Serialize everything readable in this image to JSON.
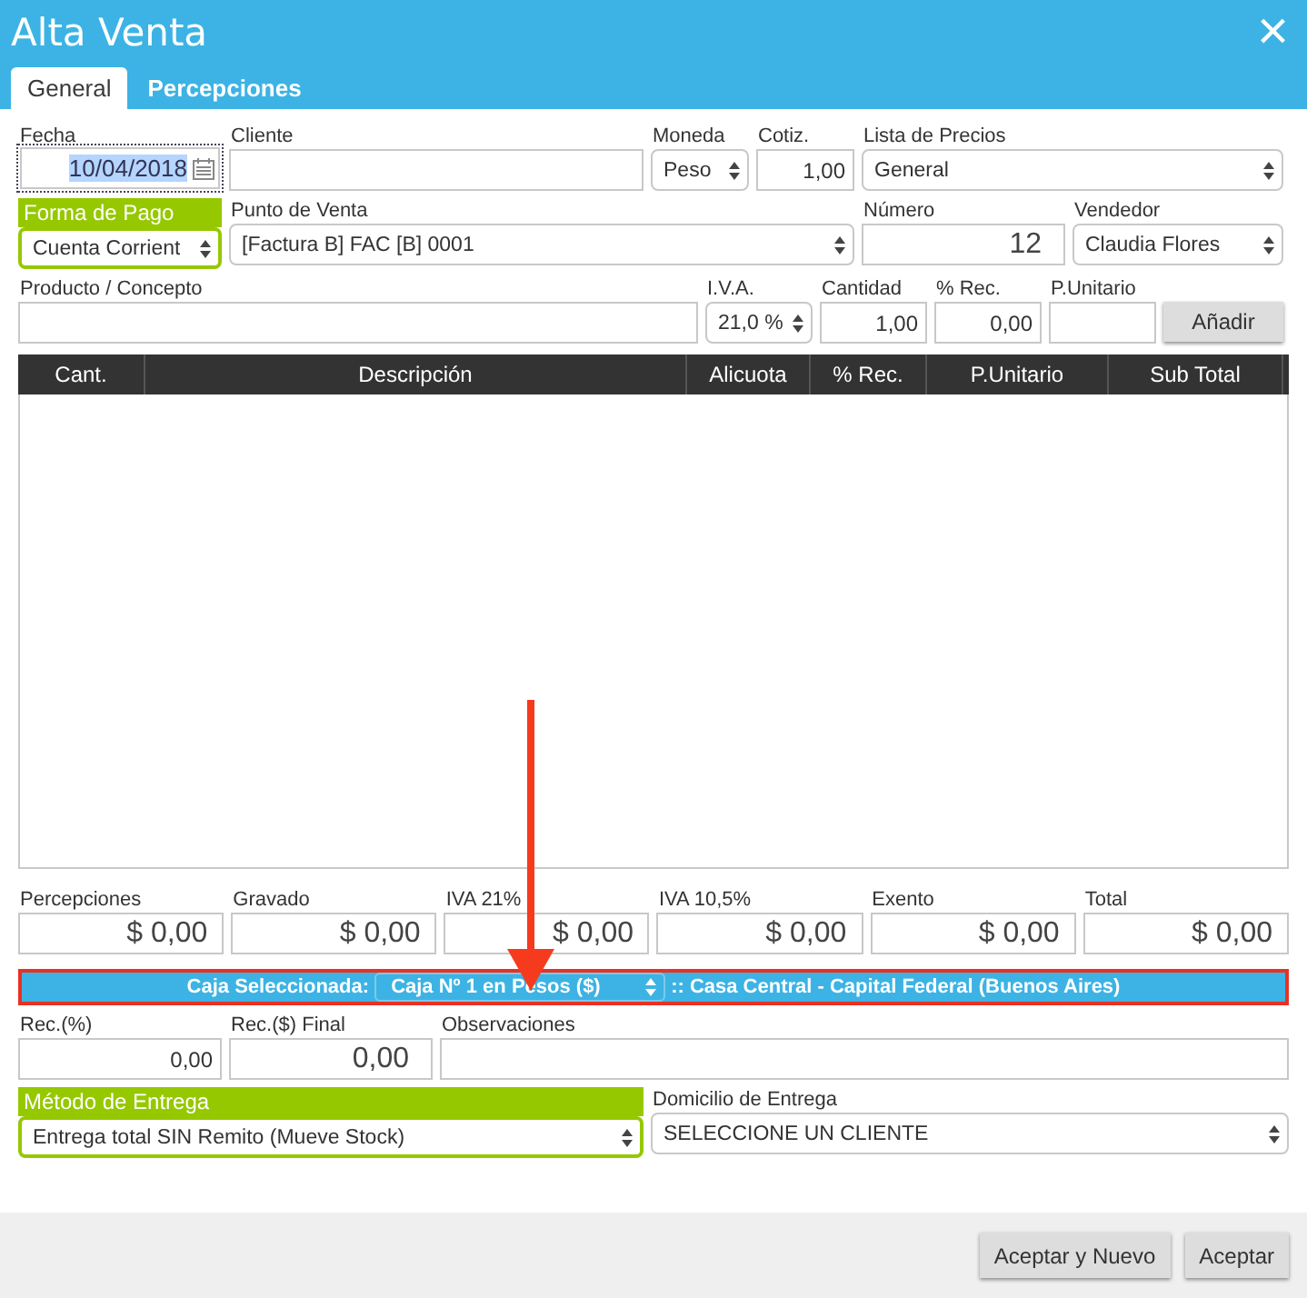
{
  "window": {
    "title": "Alta Venta",
    "close": "×"
  },
  "tabs": [
    {
      "label": "General",
      "selected": true
    },
    {
      "label": "Percepciones",
      "selected": false
    }
  ],
  "form_rows": [
    [
      {
        "label": "Fecha",
        "kind": "date",
        "value": "10/04/2018",
        "highlighted": false
      },
      {
        "label": "Cliente",
        "kind": "text",
        "highlighted": false
      },
      {
        "label": "Moneda",
        "kind": "select",
        "value": "Peso",
        "highlighted": false
      },
      {
        "label": "Cotiz.",
        "kind": "number",
        "value": "1,00",
        "highlighted": false
      },
      {
        "label": "Lista de Precios",
        "kind": "select",
        "value": "General",
        "highlighted": false
      }
    ],
    [
      {
        "label": "Forma de Pago",
        "kind": "select",
        "value": "Cuenta Corrient",
        "highlighted": true
      },
      {
        "label": "Punto de Venta",
        "kind": "select",
        "value": "[Factura B] FAC [B] 0001",
        "highlighted": false
      },
      {
        "label": "Número",
        "kind": "big",
        "value": "12",
        "highlighted": false
      },
      {
        "label": "Vendedor",
        "kind": "select",
        "value": "Claudia Flores",
        "highlighted": false
      }
    ],
    [
      {
        "label": "Producto / Concepto",
        "kind": "text",
        "highlighted": false
      },
      {
        "label": "I.V.A.",
        "kind": "select",
        "value": "21,0 %",
        "highlighted": false
      },
      {
        "label": "Cantidad",
        "kind": "number",
        "value": "1,00",
        "highlighted": false
      },
      {
        "label": "% Rec.",
        "kind": "number",
        "value": "0,00",
        "highlighted": false
      },
      {
        "label": "P.Unitario",
        "kind": "number",
        "highlighted": false
      },
      {
        "label": "Añadir",
        "kind": "button"
      }
    ]
  ],
  "table": {
    "columns": [
      "Cant.",
      "Descripción",
      "Alicuota",
      "% Rec.",
      "P.Unitario",
      "Sub Total"
    ]
  },
  "totals": [
    {
      "label": "Percepciones",
      "value": "$ 0,00"
    },
    {
      "label": "Gravado",
      "value": "$ 0,00"
    },
    {
      "label": "IVA 21%",
      "value": "$ 0,00"
    },
    {
      "label": "IVA 10,5%",
      "value": "$ 0,00"
    },
    {
      "label": "Exento",
      "value": "$ 0,00"
    },
    {
      "label": "Total",
      "value": "$ 0,00"
    }
  ],
  "caja": {
    "label": "Caja Seleccionada:",
    "value": "Caja Nº 1 en Pesos ($)",
    "location": ":: Casa Central - Capital Federal (Buenos Aires)"
  },
  "bottom_rows": [
    [
      {
        "label": "Rec.(%)",
        "kind": "number",
        "value": "0,00",
        "highlighted": false
      },
      {
        "label": "Rec.($) Final",
        "kind": "big",
        "value": "0,00",
        "highlighted": false
      },
      {
        "label": "Observaciones",
        "kind": "text",
        "highlighted": false
      }
    ],
    [
      {
        "label": "Método de Entrega",
        "kind": "select",
        "value": "Entrega total SIN Remito (Mueve Stock)",
        "highlighted": true
      },
      {
        "label": "Domicilio de Entrega",
        "kind": "select",
        "value": "SELECCIONE UN CLIENTE",
        "highlighted": false
      }
    ]
  ],
  "buttons": [
    "Aceptar y Nuevo",
    "Aceptar"
  ]
}
